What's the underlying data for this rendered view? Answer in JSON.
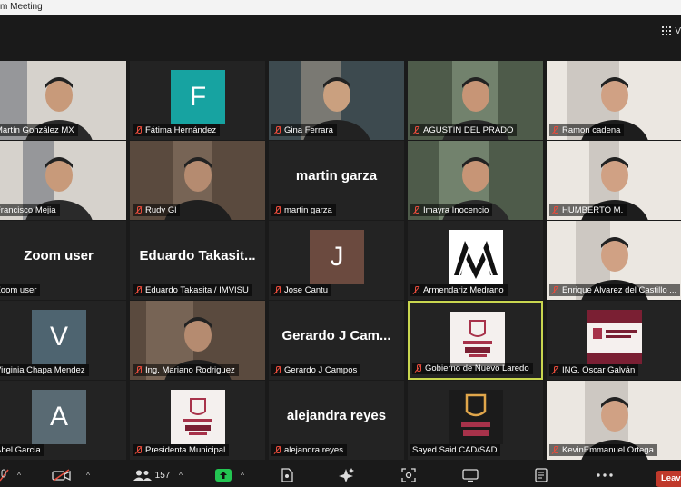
{
  "window": {
    "title": "m Meeting"
  },
  "topbar": {
    "view_label": "V"
  },
  "participants": [
    {
      "name": "Martín González MX",
      "muted": false,
      "kind": "video"
    },
    {
      "name": "Fátima Hernández",
      "muted": true,
      "kind": "avatar",
      "initial": "F",
      "color": "#17a3a1"
    },
    {
      "name": "Gina Ferrara",
      "muted": true,
      "kind": "video"
    },
    {
      "name": "AGUSTIN DEL PRADO",
      "muted": true,
      "kind": "video"
    },
    {
      "name": "Ramon cadena",
      "muted": true,
      "kind": "video"
    },
    {
      "name": "Francisco Mejia",
      "muted": false,
      "kind": "video"
    },
    {
      "name": "Rudy Gl",
      "muted": true,
      "kind": "video"
    },
    {
      "name": "martin garza",
      "muted": true,
      "kind": "text",
      "display": "martin garza"
    },
    {
      "name": "Imayra Inocencio",
      "muted": true,
      "kind": "video"
    },
    {
      "name": "HUMBERTO M.",
      "muted": true,
      "kind": "video"
    },
    {
      "name": "Zoom user",
      "muted": false,
      "kind": "text",
      "display": "Zoom user"
    },
    {
      "name": "Eduardo Takasita / IMVISU",
      "muted": true,
      "kind": "text",
      "display": "Eduardo  Takasit..."
    },
    {
      "name": "Jose Cantu",
      "muted": true,
      "kind": "avatar",
      "initial": "J",
      "color": "#6b4a3f"
    },
    {
      "name": "Armendariz Medrano",
      "muted": true,
      "kind": "logo-mm"
    },
    {
      "name": "Enrique Alvarez del Castillo ...",
      "muted": true,
      "kind": "video"
    },
    {
      "name": "Virginia Chapa Mendez",
      "muted": false,
      "kind": "avatar",
      "initial": "V",
      "color": "#4e6470"
    },
    {
      "name": "Ing. Mariano Rodriguez",
      "muted": true,
      "kind": "video"
    },
    {
      "name": "Gerardo  J Campos",
      "muted": true,
      "kind": "text",
      "display": "Gerardo   J Cam..."
    },
    {
      "name": "Gobierno de Nuevo Laredo",
      "muted": true,
      "kind": "logo-nl",
      "active": true
    },
    {
      "name": "ING. Oscar Galván",
      "muted": true,
      "kind": "poster"
    },
    {
      "name": "Abel Garcia",
      "muted": false,
      "kind": "avatar",
      "initial": "A",
      "color": "#596a73"
    },
    {
      "name": "Presidenta Municipal",
      "muted": true,
      "kind": "logo-nl2"
    },
    {
      "name": "alejandra reyes",
      "muted": true,
      "kind": "text",
      "display": "alejandra reyes"
    },
    {
      "name": "Sayed Said CAD/SAD",
      "muted": false,
      "kind": "logo-dark"
    },
    {
      "name": "KevinEmmanuel Ortega",
      "muted": true,
      "kind": "video"
    }
  ],
  "toolbar": {
    "participants_count": "157",
    "leave_label": "Leav"
  },
  "colors": {
    "active_speaker": "#c9d64f",
    "leave": "#c0392b",
    "mute": "#e74c3c"
  }
}
